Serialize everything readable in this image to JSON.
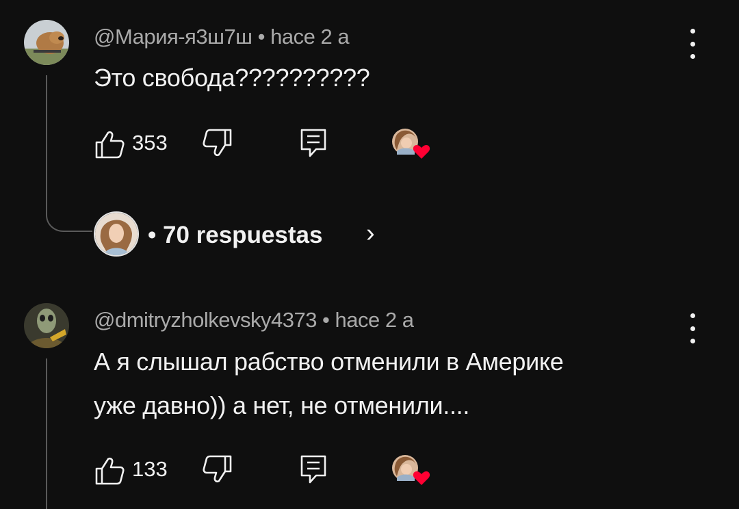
{
  "comments": [
    {
      "author": "@Мария-я3ш7ш",
      "time": "hace 2 a",
      "text": "Это свобода??????????",
      "likes": "353"
    },
    {
      "author": "@dmitryzholkevsky4373",
      "time": "hace 2 a",
      "text_line1": "А я слышал рабство отменили в Америке",
      "text_line2": "уже давно)) а нет, не отменили....",
      "likes": "133"
    }
  ],
  "replies": {
    "label": "• 70 respuestas",
    "chevron": "›"
  },
  "separator": " • ",
  "icons": [
    "like-icon",
    "dislike-icon",
    "reply-icon",
    "creator-heart-icon",
    "more-icon"
  ],
  "colors": {
    "background": "#0f0f0f",
    "text": "#f1f1f1",
    "meta": "#aaaaaa",
    "heart": "#ff0033"
  }
}
